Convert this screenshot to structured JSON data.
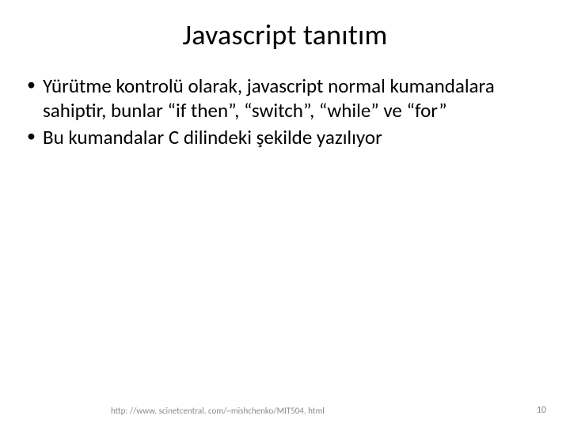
{
  "title": "Javascript tanıtım",
  "bullets": [
    "Yürütme kontrolü olarak, javascript normal kumandalara sahiptir, bunlar “if then”, “switch”, “while” ve “for”",
    "Bu kumandalar C dilindeki şekilde yazılıyor"
  ],
  "footer_url": "http: //www. scinetcentral. com/~mishchenko/MIT504. html",
  "page_number": "10"
}
